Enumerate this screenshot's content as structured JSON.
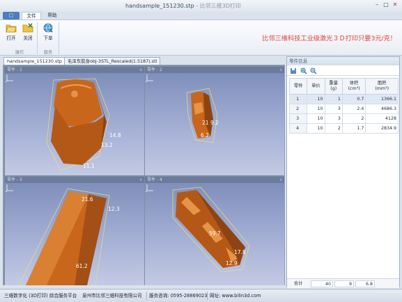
{
  "window": {
    "title": "handsample_151230.stp",
    "subtitle": "- 比邻三维3D打印"
  },
  "menu": {
    "tabs": [
      "文件",
      "帮助"
    ],
    "app_button": "□"
  },
  "ribbon": {
    "open": "打开",
    "close": "关闭",
    "order": "下单",
    "group_operate": "操作",
    "group_service": "服务"
  },
  "promo": "比邻三维科技工业级激光３Ｄ打印只要3元/克！",
  "doc_tabs": [
    "handsample_151230.stp",
    "毛泽东胶身obj-3STL_Rescaled(1.5187).stl"
  ],
  "viewports": [
    {
      "label": "零件 - 1",
      "dims": [
        "14.8",
        "13.2",
        "11.1"
      ]
    },
    {
      "label": "零件 - 2",
      "dims": [
        "21",
        "9.2",
        "6.2"
      ]
    },
    {
      "label": "零件 - 3",
      "dims": [
        "21.6",
        "12.3",
        "61.2"
      ]
    },
    {
      "label": "零件 - 4",
      "dims": [
        "59.7",
        "17.8",
        "12.9"
      ]
    }
  ],
  "close_glyph": "x",
  "panel": {
    "title": "零件信息",
    "headers": [
      "零件",
      "单价",
      "重量\n(g)",
      "体积\n(cm³)",
      "面积\n(mm²)"
    ],
    "rows": [
      [
        "1",
        "10",
        "1",
        "0.7",
        "1366.1"
      ],
      [
        "2",
        "10",
        "3",
        "2.4",
        "4686.3"
      ],
      [
        "3",
        "10",
        "3",
        "2",
        "4128"
      ],
      [
        "4",
        "10",
        "2",
        "1.7",
        "2834.9"
      ]
    ],
    "total_label": "合计",
    "total_price": "40",
    "total_weight": "9",
    "total_volume": "6.8"
  },
  "status": {
    "left": "三维数字化 (3D打印) 综合服务平台",
    "company": "泉州市比邻三维科技有限公司",
    "phone": "服务咨询: 0595-28869023",
    "web": "网址: www.bilin3d.com"
  },
  "colors": {
    "accent": "#d96f1c",
    "promo": "#e0403c",
    "viewport_bg": "#8f9cc6"
  }
}
